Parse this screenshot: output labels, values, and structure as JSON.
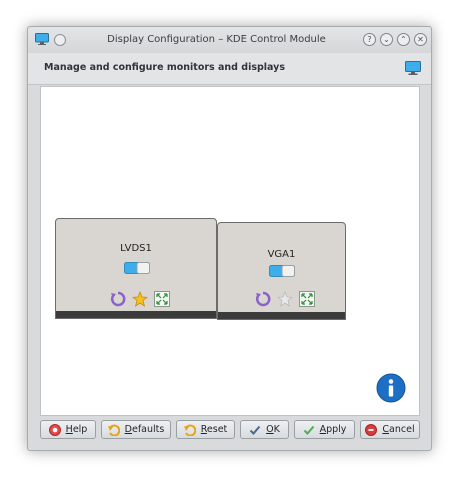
{
  "window": {
    "title": "Display Configuration – KDE Control Module",
    "buttons": {
      "help": "?",
      "minimize": "⌄",
      "maximize": "⌃",
      "close": "✕"
    }
  },
  "header": {
    "text": "Manage and configure monitors and displays"
  },
  "monitors": [
    {
      "name": "LVDS1",
      "enabled": true,
      "primary": true
    },
    {
      "name": "VGA1",
      "enabled": true,
      "primary": false
    }
  ],
  "buttons": {
    "help": "Help",
    "defaults": "Defaults",
    "reset": "Reset",
    "ok": "OK",
    "apply": "Apply",
    "cancel": "Cancel"
  },
  "colors": {
    "accent": "#3daee9",
    "monitor_bg": "#d9d6d1",
    "monitor_bar": "#3b3b3b",
    "info_blue": "#1d6fc4"
  },
  "icons": {
    "rotate": "rotate-icon",
    "primary": "star-icon",
    "resize": "resize-icon",
    "info": "info-icon"
  }
}
